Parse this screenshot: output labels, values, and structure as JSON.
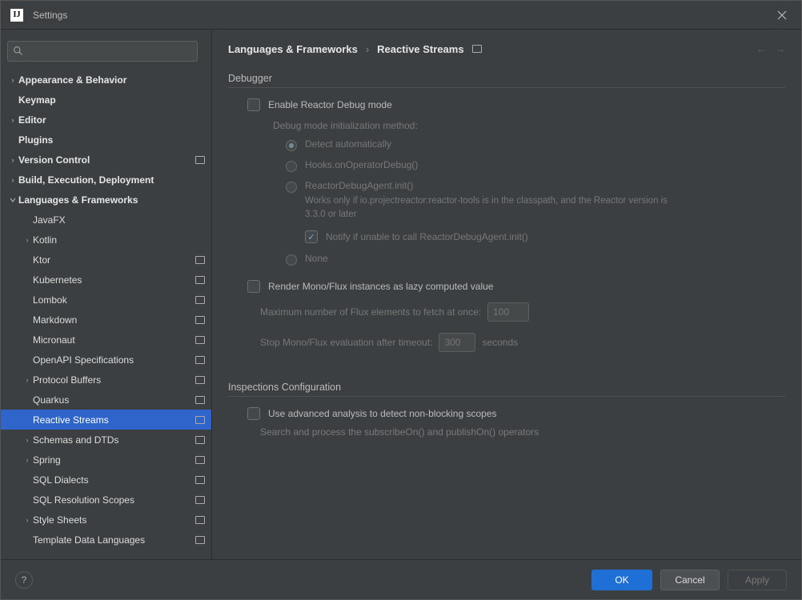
{
  "window": {
    "title": "Settings"
  },
  "search": {
    "placeholder": ""
  },
  "tree": [
    {
      "label": "Appearance & Behavior",
      "bold": true,
      "arrow": ">",
      "indent": 0,
      "proj": false
    },
    {
      "label": "Keymap",
      "bold": true,
      "arrow": "",
      "indent": 0,
      "proj": false
    },
    {
      "label": "Editor",
      "bold": true,
      "arrow": ">",
      "indent": 0,
      "proj": false
    },
    {
      "label": "Plugins",
      "bold": true,
      "arrow": "",
      "indent": 0,
      "proj": false
    },
    {
      "label": "Version Control",
      "bold": true,
      "arrow": ">",
      "indent": 0,
      "proj": true
    },
    {
      "label": "Build, Execution, Deployment",
      "bold": true,
      "arrow": ">",
      "indent": 0,
      "proj": false
    },
    {
      "label": "Languages & Frameworks",
      "bold": true,
      "arrow": "v",
      "indent": 0,
      "proj": false
    },
    {
      "label": "JavaFX",
      "bold": false,
      "arrow": "",
      "indent": 1,
      "proj": false
    },
    {
      "label": "Kotlin",
      "bold": false,
      "arrow": ">",
      "indent": 1,
      "proj": false
    },
    {
      "label": "Ktor",
      "bold": false,
      "arrow": "",
      "indent": 1,
      "proj": true
    },
    {
      "label": "Kubernetes",
      "bold": false,
      "arrow": "",
      "indent": 1,
      "proj": true
    },
    {
      "label": "Lombok",
      "bold": false,
      "arrow": "",
      "indent": 1,
      "proj": true
    },
    {
      "label": "Markdown",
      "bold": false,
      "arrow": "",
      "indent": 1,
      "proj": true
    },
    {
      "label": "Micronaut",
      "bold": false,
      "arrow": "",
      "indent": 1,
      "proj": true
    },
    {
      "label": "OpenAPI Specifications",
      "bold": false,
      "arrow": "",
      "indent": 1,
      "proj": true
    },
    {
      "label": "Protocol Buffers",
      "bold": false,
      "arrow": ">",
      "indent": 1,
      "proj": true
    },
    {
      "label": "Quarkus",
      "bold": false,
      "arrow": "",
      "indent": 1,
      "proj": true
    },
    {
      "label": "Reactive Streams",
      "bold": false,
      "arrow": "",
      "indent": 1,
      "proj": true,
      "selected": true
    },
    {
      "label": "Schemas and DTDs",
      "bold": false,
      "arrow": ">",
      "indent": 1,
      "proj": true
    },
    {
      "label": "Spring",
      "bold": false,
      "arrow": ">",
      "indent": 1,
      "proj": true
    },
    {
      "label": "SQL Dialects",
      "bold": false,
      "arrow": "",
      "indent": 1,
      "proj": true
    },
    {
      "label": "SQL Resolution Scopes",
      "bold": false,
      "arrow": "",
      "indent": 1,
      "proj": true
    },
    {
      "label": "Style Sheets",
      "bold": false,
      "arrow": ">",
      "indent": 1,
      "proj": true
    },
    {
      "label": "Template Data Languages",
      "bold": false,
      "arrow": "",
      "indent": 1,
      "proj": true
    }
  ],
  "breadcrumb": {
    "seg1": "Languages & Frameworks",
    "seg2": "Reactive Streams"
  },
  "sections": {
    "debugger": {
      "title": "Debugger",
      "enable_label": "Enable Reactor Debug mode",
      "init_method": "Debug mode initialization method:",
      "radio_auto": "Detect automatically",
      "radio_hooks": "Hooks.onOperatorDebug()",
      "radio_agent": "ReactorDebugAgent.init()",
      "agent_helper": "Works only if io.projectreactor:reactor-tools is in the classpath, and the Reactor version is 3.3.0 or later",
      "notify_label": "Notify if unable to call ReactorDebugAgent.init()",
      "radio_none": "None",
      "render_label": "Render Mono/Flux instances as lazy computed value",
      "max_flux_label": "Maximum number of Flux elements to fetch at once:",
      "max_flux_value": "100",
      "timeout_label": "Stop Mono/Flux evaluation after timeout:",
      "timeout_value": "300",
      "timeout_unit": "seconds"
    },
    "inspections": {
      "title": "Inspections Configuration",
      "advanced_label": "Use advanced analysis to detect non-blocking scopes",
      "advanced_helper": "Search and process the subscribeOn() and publishOn() operators"
    }
  },
  "footer": {
    "ok": "OK",
    "cancel": "Cancel",
    "apply": "Apply"
  }
}
